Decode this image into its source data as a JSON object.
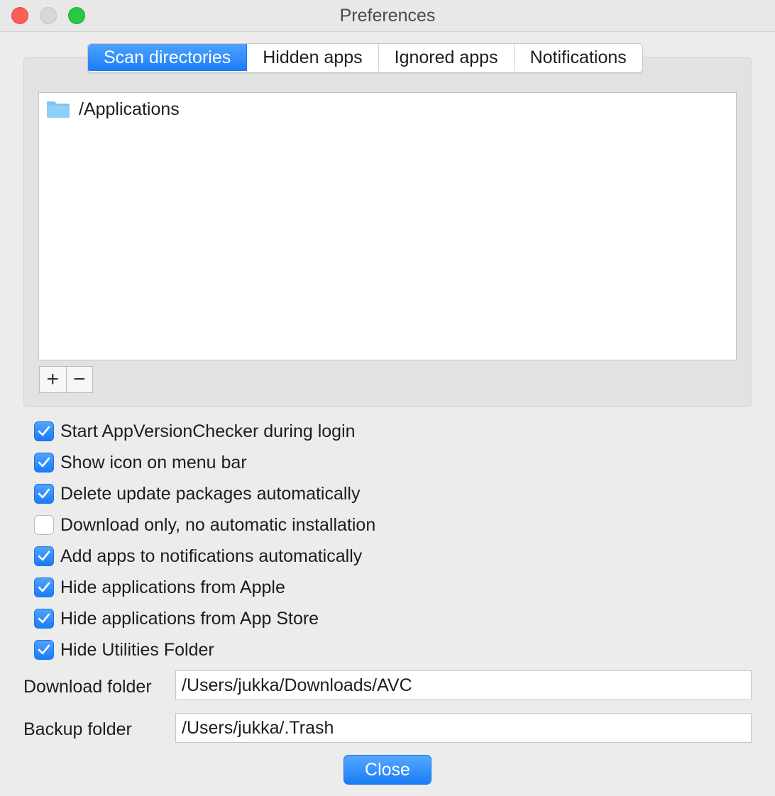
{
  "window": {
    "title": "Preferences"
  },
  "tabs": [
    {
      "label": "Scan directories",
      "active": true
    },
    {
      "label": "Hidden apps",
      "active": false
    },
    {
      "label": "Ignored apps",
      "active": false
    },
    {
      "label": "Notifications",
      "active": false
    }
  ],
  "scan_list": {
    "items": [
      {
        "icon": "folder-icon",
        "path": "/Applications"
      }
    ],
    "add_label": "+",
    "remove_label": "−"
  },
  "options": [
    {
      "label": "Start AppVersionChecker during login",
      "checked": true
    },
    {
      "label": "Show icon on menu bar",
      "checked": true
    },
    {
      "label": "Delete update packages automatically",
      "checked": true
    },
    {
      "label": "Download only, no automatic installation",
      "checked": false
    },
    {
      "label": "Add apps to notifications automatically",
      "checked": true
    },
    {
      "label": "Hide applications from Apple",
      "checked": true
    },
    {
      "label": "Hide applications from App Store",
      "checked": true
    },
    {
      "label": "Hide Utilities Folder",
      "checked": true
    }
  ],
  "folders": {
    "download_label": "Download folder",
    "download_value": "/Users/jukka/Downloads/AVC",
    "backup_label": "Backup folder",
    "backup_value": "/Users/jukka/.Trash"
  },
  "footer": {
    "close_label": "Close"
  },
  "colors": {
    "accent": "#1a7cf5",
    "folder": "#7cc4f4"
  }
}
